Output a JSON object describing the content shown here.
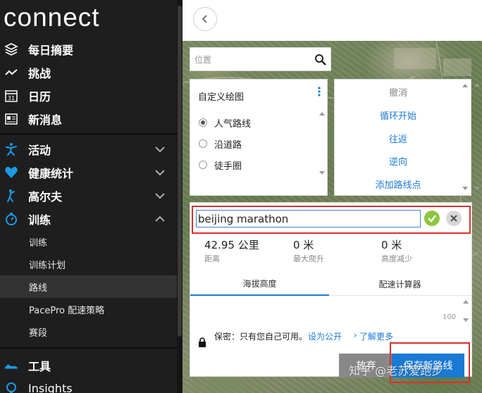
{
  "app": {
    "logo": "connect"
  },
  "sidebar": {
    "items": [
      {
        "label": "每日摘要",
        "icon": "layers-icon"
      },
      {
        "label": "挑战",
        "icon": "challenge-icon"
      },
      {
        "label": "日历",
        "icon": "calendar-icon",
        "calendar_day": "31"
      },
      {
        "label": "新消息",
        "icon": "news-icon"
      },
      {
        "label": "活动",
        "icon": "activity-icon"
      },
      {
        "label": "健康统计",
        "icon": "heart-icon"
      },
      {
        "label": "高尔夫",
        "icon": "golf-icon"
      },
      {
        "label": "训练",
        "icon": "stopwatch-icon"
      },
      {
        "label": "工具",
        "icon": "shoe-icon"
      },
      {
        "label": "Insights",
        "icon": "insights-icon"
      }
    ],
    "training_subitems": [
      "训练",
      "训练计划",
      "路线",
      "PacePro 配速策略",
      "赛段"
    ],
    "active_subitem": "路线"
  },
  "map": {
    "search_placeholder": "位置",
    "draw_panel": {
      "title": "自定义绘图",
      "options": [
        "人气路线",
        "沿道路",
        "徒手圈"
      ],
      "selected": "人气路线"
    },
    "actions": {
      "undo": "撤消",
      "loop_start": "循环开始",
      "round_trip": "往返",
      "reverse": "逆向",
      "add_waypoint": "添加路线点"
    }
  },
  "route": {
    "name": "beijing marathon",
    "stats": [
      {
        "value": "42.95 公里",
        "label": "距离"
      },
      {
        "value": "0 米",
        "label": "最大爬升"
      },
      {
        "value": "0 米",
        "label": "高度减少"
      }
    ],
    "tabs": [
      "海拔高度",
      "配速计算器"
    ],
    "active_tab": "海拔高度",
    "chart_axis_label": "100",
    "privacy_text": "保密：只有您自己可用。",
    "make_public": "设为公开",
    "learn_more": "了解更多",
    "cancel_label": "放弃",
    "save_label": "保存新路线"
  },
  "watermark": "知乎 @老苏爱跑步",
  "colors": {
    "accent": "#1a7ad4",
    "highlight_box": "#d9302c",
    "confirm": "#8cc63f",
    "sidebar_bg": "#1e1e1e"
  }
}
